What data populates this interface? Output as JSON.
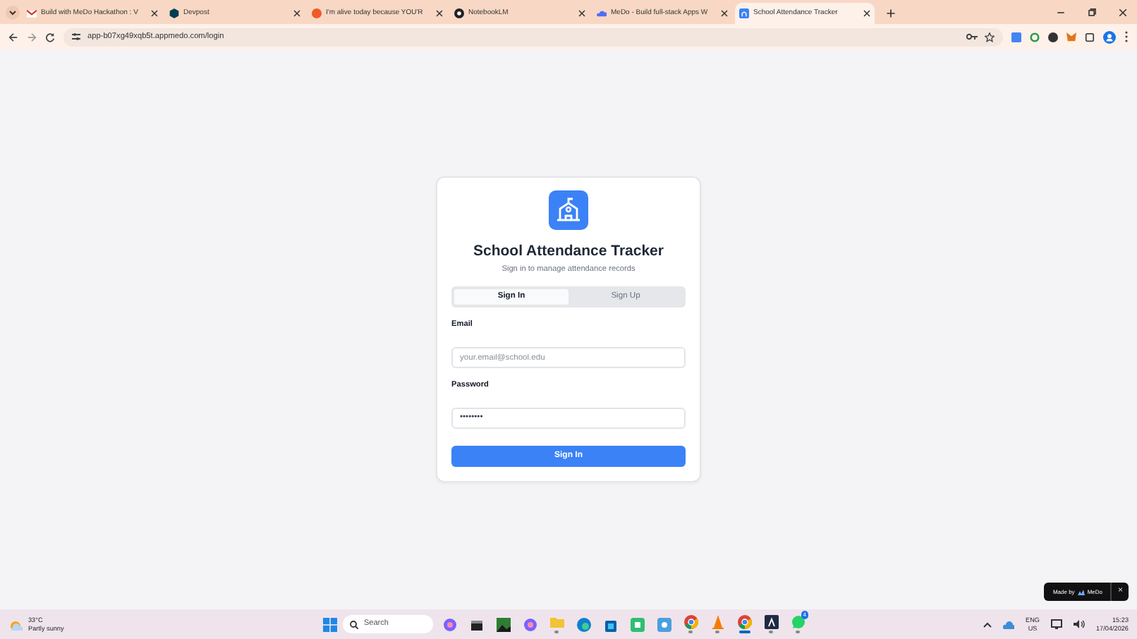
{
  "browser": {
    "tabs": [
      {
        "title": "Build with MeDo Hackathon : V",
        "selected": false
      },
      {
        "title": "Devpost",
        "selected": false
      },
      {
        "title": "I'm alive today because YOU'R",
        "selected": false
      },
      {
        "title": "NotebookLM",
        "selected": false
      },
      {
        "title": "MeDo - Build full-stack Apps W",
        "selected": false
      },
      {
        "title": "School Attendance Tracker",
        "selected": true
      }
    ],
    "url": "app-b07xg49xqb5t.appmedo.com/login"
  },
  "login": {
    "title": "School Attendance Tracker",
    "subtitle": "Sign in to manage attendance records",
    "tabs": [
      {
        "label": "Sign In",
        "selected": true
      },
      {
        "label": "Sign Up",
        "selected": false
      }
    ],
    "fields": [
      {
        "label": "Email",
        "placeholder": "your.email@school.edu"
      },
      {
        "label": "Password",
        "value": "••••••••"
      }
    ],
    "button": "Sign In"
  },
  "badge": {
    "text": "Made by",
    "brand": "MeDo",
    "close": "×"
  },
  "taskbar": {
    "weather": {
      "temp": "33°C",
      "text": "Partly sunny"
    },
    "search": "Search",
    "apps": [
      {
        "kind": "copilot",
        "running": false
      },
      {
        "kind": "files",
        "running": false
      },
      {
        "kind": "photo",
        "running": false
      },
      {
        "kind": "copilot",
        "running": false
      },
      {
        "kind": "folder",
        "running": true
      },
      {
        "kind": "edge",
        "running": false
      },
      {
        "kind": "store",
        "running": false
      },
      {
        "kind": "green",
        "running": false
      },
      {
        "kind": "blue",
        "running": false
      },
      {
        "kind": "chrome",
        "running": true
      },
      {
        "kind": "cone",
        "running": true
      },
      {
        "kind": "chrome",
        "running": true,
        "active": true
      },
      {
        "kind": "dark",
        "running": true
      },
      {
        "kind": "whatsapp",
        "running": true,
        "badge": "4"
      }
    ],
    "lang": "ENG",
    "region": "US",
    "time": "15:23",
    "date": "17/04/2026"
  }
}
